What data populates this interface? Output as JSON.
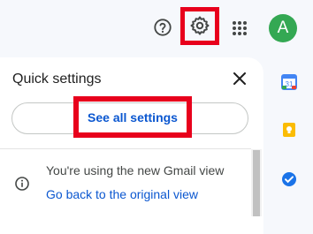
{
  "header": {
    "help_icon": "help-circle-icon",
    "settings_icon": "gear-icon",
    "apps_icon": "apps-grid-icon",
    "avatar_letter": "A",
    "avatar_color": "#34a853",
    "highlight_color": "#e8001c"
  },
  "quick_settings": {
    "title": "Quick settings",
    "close_icon": "close-icon",
    "see_all_label": "See all settings",
    "notice_text": "You're using the new Gmail view",
    "go_back_link": "Go back to the original view",
    "info_icon": "info-icon"
  },
  "side_panel": {
    "apps": [
      "calendar-icon",
      "keep-icon",
      "tasks-icon"
    ]
  }
}
